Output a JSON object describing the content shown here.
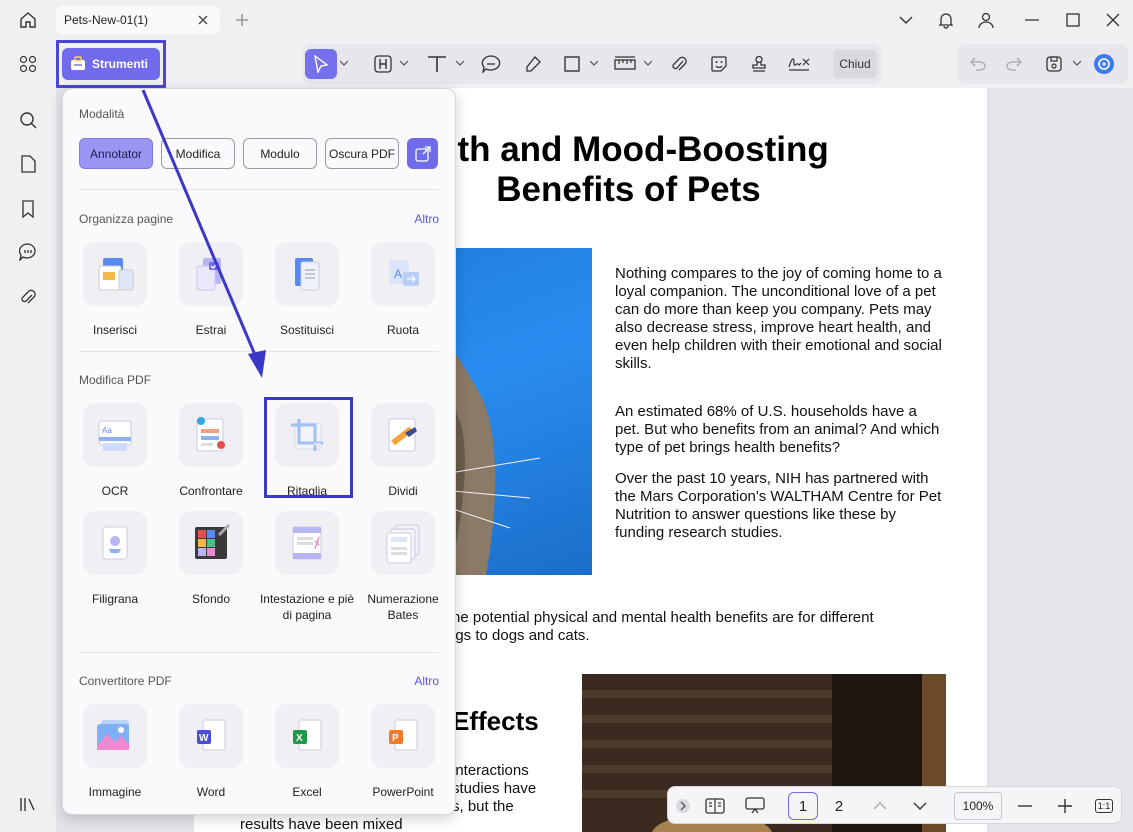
{
  "window": {
    "tab_title": "Pets-New-01(1)"
  },
  "toolbar": {
    "strumenti_label": "Strumenti",
    "close_label": "Chiud"
  },
  "tools_panel": {
    "modes_title": "Modalità",
    "modes": [
      "Annotator",
      "Modifica",
      "Modulo",
      "Oscura PDF"
    ],
    "organize": {
      "title": "Organizza pagine",
      "more": "Altro",
      "items": [
        "Inserisci",
        "Estrai",
        "Sostituisci",
        "Ruota"
      ]
    },
    "modify": {
      "title": "Modifica PDF",
      "items": [
        "OCR",
        "Confrontare",
        "Ritaglia",
        "Dividi",
        "Filigrana",
        "Sfondo",
        "Intestazione e piè di pagina",
        "Numerazione Bates"
      ]
    },
    "convert": {
      "title": "Convertitore PDF",
      "more": "Altro",
      "items": [
        "Immagine",
        "Word",
        "Excel",
        "PowerPoint"
      ]
    }
  },
  "document": {
    "title_line1": "alth and Mood-Boosting",
    "title_line2": "Benefits of Pets",
    "p1": "Nothing compares to the joy of coming home to a loyal companion. The unconditional love of a pet can do more than keep you company. Pets may also decrease stress, improve heart health, and even help children with their emotional and social skills.",
    "p2": "An estimated 68% of U.S. households have a pet. But who benefits from an animal? And which type of pet brings health benefits?",
    "p3": "Over the past 10 years, NIH has partnered with the Mars Corporation's WALTHAM Centre for Pet Nutrition to answer questions like these by funding research studies.",
    "p4_line1": "he potential physical and mental health benefits are for different",
    "p4_line2": "igs to dogs and cats.",
    "heading_effects": "Effects",
    "frag1": "interactions",
    "frag2": "studies have",
    "frag3": "s, but the",
    "frag4": "results have been mixed"
  },
  "bottom_bar": {
    "page1": "1",
    "page2": "2",
    "zoom": "100%",
    "fit": "1:1"
  },
  "colors": {
    "accent": "#6f6bea",
    "highlight": "#3b38c8"
  }
}
